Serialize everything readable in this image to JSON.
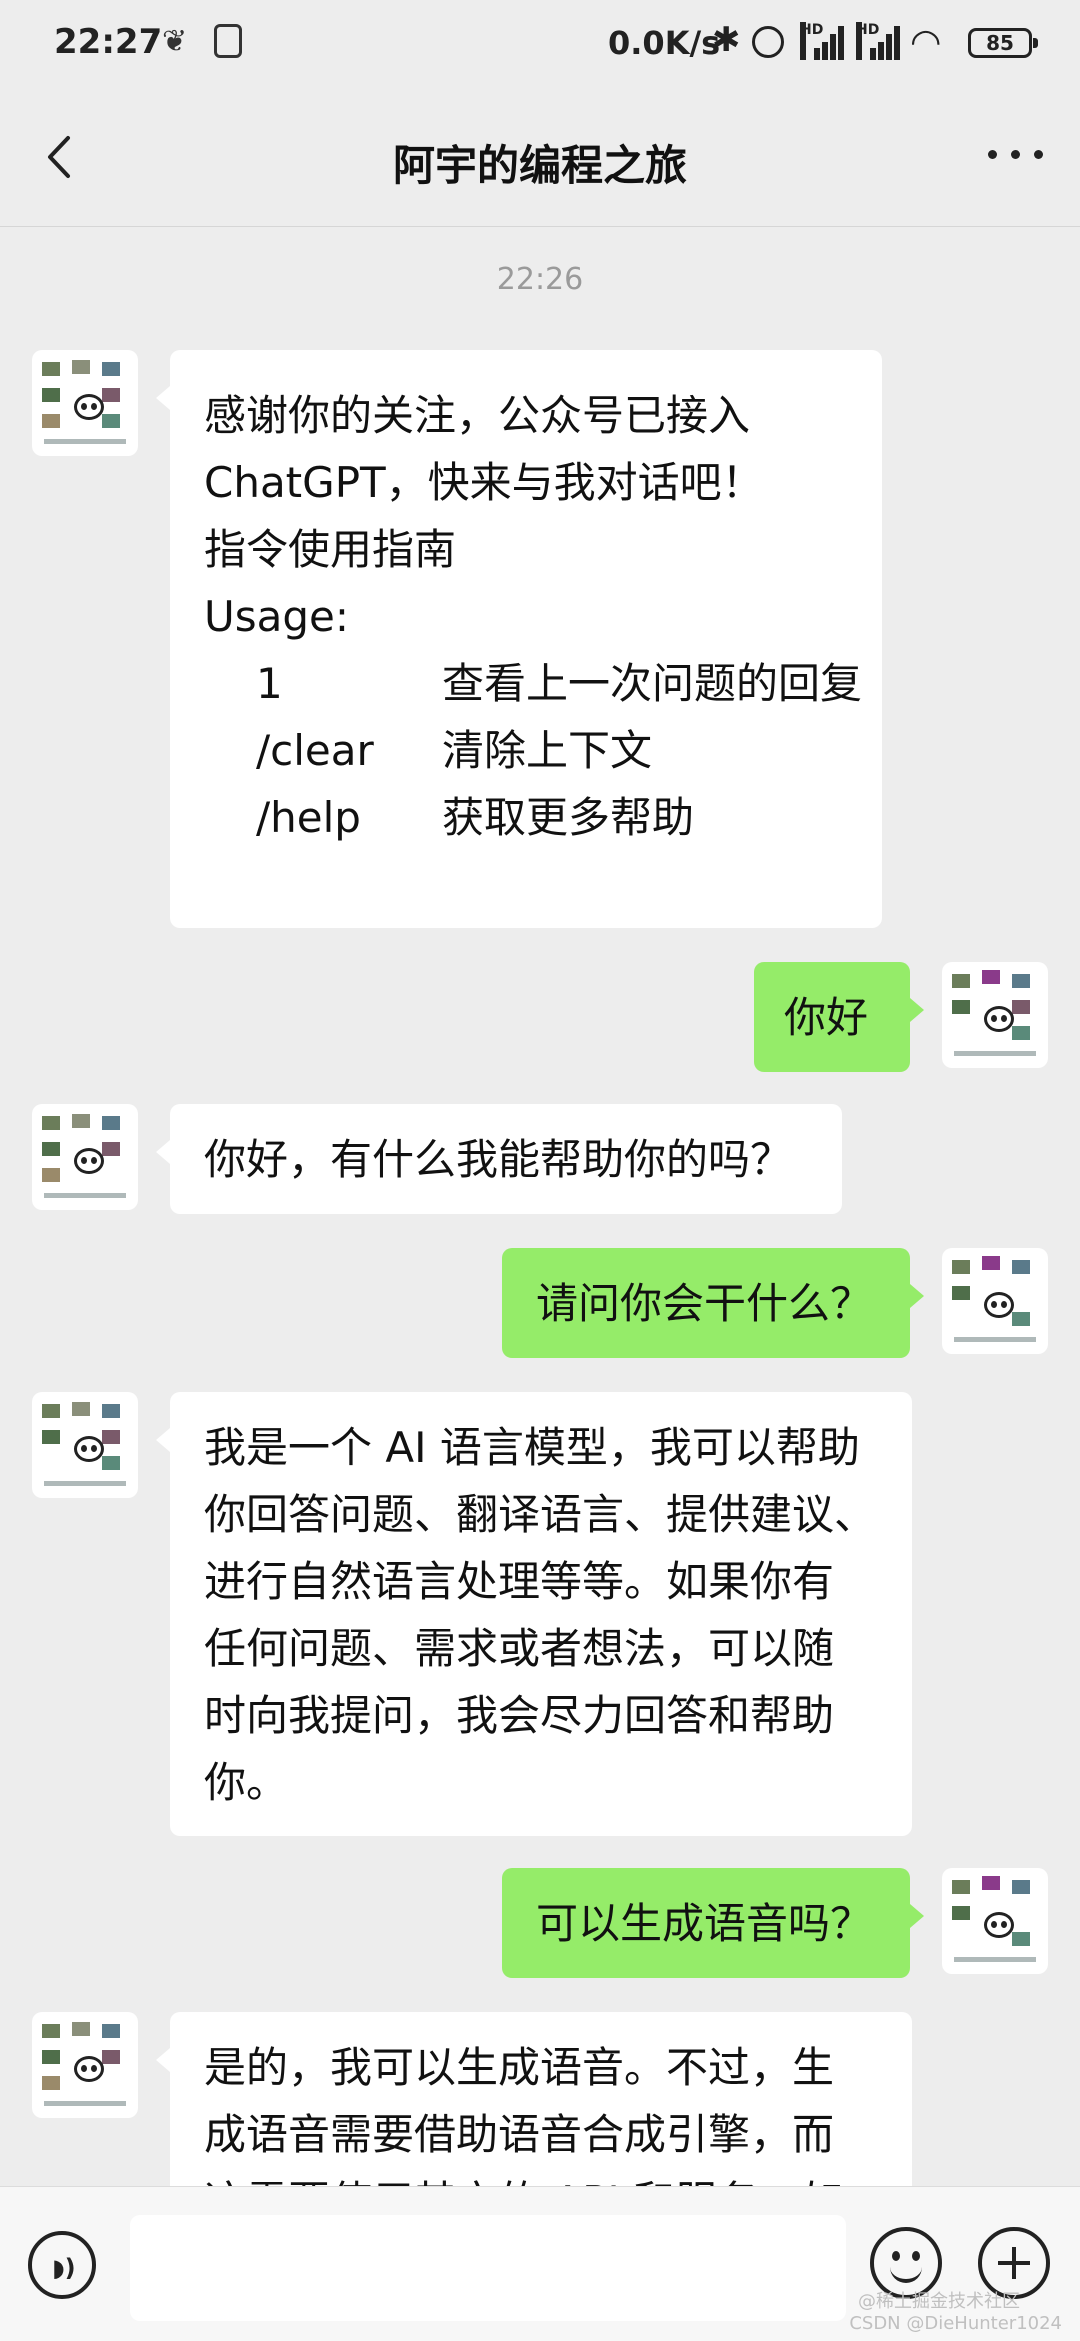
{
  "status_bar": {
    "time": "22:27",
    "net_speed": "0.0K/s",
    "hd_label": "HD",
    "battery": "85"
  },
  "header": {
    "title": "阿宇的编程之旅"
  },
  "chat": {
    "timestamp": "22:26",
    "welcome": {
      "lines": [
        "感谢你的关注，公众号已接入",
        "ChatGPT，快来与我对话吧！",
        "指令使用指南",
        "Usage:"
      ],
      "usage": [
        {
          "cmd": "1",
          "desc": "查看上一次问题的回复"
        },
        {
          "cmd": "/clear",
          "desc": "清除上下文"
        },
        {
          "cmd": "/help",
          "desc": "获取更多帮助"
        }
      ]
    },
    "msg_hello": "你好",
    "reply_hello": "你好，有什么我能帮助你的吗？",
    "msg_ask": "请问你会干什么？",
    "reply_ask_lines": [
      "我是一个 AI 语言模型，我可以帮助",
      "你回答问题、翻译语言、提供建议、",
      "进行自然语言处理等等。如果你有",
      "任何问题、需求或者想法，可以随",
      "时向我提问，我会尽力回答和帮助",
      "你。"
    ],
    "msg_voice": "可以生成语音吗？",
    "reply_voice_lines": [
      "是的，我可以生成语音。不过，生",
      "成语音需要借助语音合成引擎，而",
      "这需要使用其它的 API 和服务。如"
    ]
  },
  "input_bar": {
    "placeholder": ""
  },
  "watermark": {
    "line1": "@稀土掘金技术社区",
    "line2": "CSDN @DieHunter1024"
  },
  "colors": {
    "background": "#ededed",
    "bubble_out": "#95ec69",
    "bubble_in": "#ffffff"
  }
}
